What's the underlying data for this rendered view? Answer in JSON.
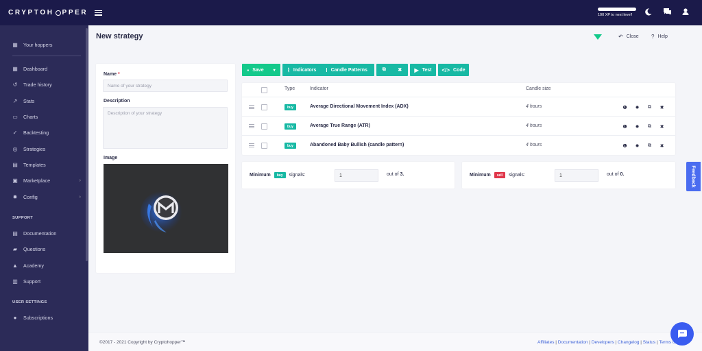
{
  "topbar": {
    "logo_pre": "CRYPTOH",
    "logo_post": "PPER",
    "xp_text": "100 XP to next level!"
  },
  "sidebar": {
    "hoppers": "Your hoppers",
    "items": [
      {
        "label": "Dashboard",
        "icon": "dashboard-icon"
      },
      {
        "label": "Trade history",
        "icon": "history-icon"
      },
      {
        "label": "Stats",
        "icon": "stats-icon"
      },
      {
        "label": "Charts",
        "icon": "charts-icon"
      },
      {
        "label": "Backtesting",
        "icon": "backtesting-icon"
      },
      {
        "label": "Strategies",
        "icon": "strategies-icon"
      },
      {
        "label": "Templates",
        "icon": "templates-icon"
      },
      {
        "label": "Marketplace",
        "icon": "marketplace-icon"
      },
      {
        "label": "Config",
        "icon": "config-icon"
      }
    ],
    "support_title": "SUPPORT",
    "support_items": [
      {
        "label": "Documentation",
        "icon": "documentation-icon"
      },
      {
        "label": "Questions",
        "icon": "questions-icon"
      },
      {
        "label": "Academy",
        "icon": "academy-icon"
      },
      {
        "label": "Support",
        "icon": "support-icon"
      }
    ],
    "settings_title": "USER SETTINGS",
    "settings_items": [
      {
        "label": "Subscriptions",
        "icon": "subscriptions-icon"
      }
    ]
  },
  "header": {
    "title": "New strategy",
    "close": "Close",
    "help": "Help"
  },
  "form": {
    "name_label": "Name",
    "name_placeholder": "Name of your strategy",
    "description_label": "Description",
    "description_placeholder": "Description of your strategy",
    "image_label": "Image"
  },
  "toolbar": {
    "save": "Save",
    "indicators": "Indicators",
    "candle_patterns": "Candle Patterns",
    "test": "Test",
    "code": "Code"
  },
  "table": {
    "headers": {
      "type": "Type",
      "indicator": "Indicator",
      "candle_size": "Candle size"
    },
    "rows": [
      {
        "type": "buy",
        "indicator": "Average Directional Movement Index (ADX)",
        "candle_size": "4 hours"
      },
      {
        "type": "buy",
        "indicator": "Average True Range (ATR)",
        "candle_size": "4 hours"
      },
      {
        "type": "buy",
        "indicator": "Abandoned Baby Bullish (candle pattern)",
        "candle_size": "4 hours"
      }
    ]
  },
  "signals": {
    "buy": {
      "minimum": "Minimum",
      "badge": "buy",
      "signals": "signals:",
      "value": "1",
      "out_of": "out of",
      "total": "3."
    },
    "sell": {
      "minimum": "Minimum",
      "badge": "sell",
      "signals": "signals:",
      "value": "1",
      "out_of": "out of",
      "total": "0."
    }
  },
  "feedback": "Feedback",
  "footer": {
    "copyright": "©2017 - 2021  Copyright by Cryptohopper™",
    "links": [
      "Affiliates",
      "Documentation",
      "Developers",
      "Changelog",
      "Status",
      "Terms of Use"
    ]
  },
  "colors": {
    "brand_dark": "#1b1a4a",
    "sidebar": "#2c2b58",
    "accent": "#18b9a4",
    "save": "#14c98b",
    "sell": "#e0374b",
    "feedback": "#4a6cf0"
  }
}
